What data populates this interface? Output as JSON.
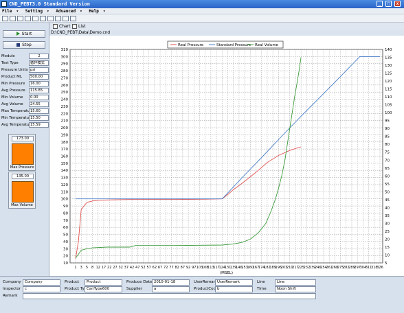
{
  "window": {
    "title": "CND_PEBT3.0 Standard Version"
  },
  "menu": {
    "file": "File",
    "setting": "Setting",
    "advanced": "Advanced",
    "help": "Help"
  },
  "controls": {
    "start_label": "Start",
    "stop_label": "Stop"
  },
  "params": [
    {
      "label": "Module",
      "value": "2"
    },
    {
      "label": "Test Type",
      "value": "循环模式"
    },
    {
      "label": "Pressure Units",
      "value": "psi"
    },
    {
      "label": "Product ML",
      "value": "500.00"
    },
    {
      "label": "Min Pressure",
      "value": "16.00"
    },
    {
      "label": "Avg Pressure",
      "value": "115.85"
    },
    {
      "label": "Min Volume",
      "value": "0.00"
    },
    {
      "label": "Avg Volume",
      "value": "24.55"
    },
    {
      "label": "Max Temperature",
      "value": "15.60"
    },
    {
      "label": "Min Temperature",
      "value": "15.50"
    },
    {
      "label": "Avg Temperature",
      "value": "15.59"
    }
  ],
  "gauges": [
    {
      "value": "173.00",
      "label": "Max Pressure",
      "fill": 1.0
    },
    {
      "value": "135.00",
      "label": "Max Volume",
      "fill": 1.0
    }
  ],
  "tabs": [
    {
      "label": "Chart"
    },
    {
      "label": "List"
    }
  ],
  "file_path": "D:\\CND_PEBT\\Data\\Demo.cnd",
  "colors": {
    "real_pressure": "#e05050",
    "standard_pressure": "#4a7fc8",
    "real_volume": "#3a9a3a",
    "gauge_fill": "#ff8000",
    "title_bar": "#2a64c8"
  },
  "chart_data": {
    "type": "line",
    "xlabel": "(MSEL)",
    "x_ticks": [
      "1",
      "3",
      "5",
      "8",
      "12",
      "17",
      "22",
      "27",
      "32",
      "37",
      "42",
      "47",
      "52",
      "57",
      "62",
      "67",
      "72",
      "77",
      "82",
      "87",
      "92",
      "97",
      "103",
      "108",
      "113",
      "117",
      "124",
      "131",
      "139",
      "146",
      "153",
      "160",
      "167",
      "174",
      "182",
      "189",
      "196",
      "203",
      "210",
      "217",
      "225",
      "232",
      "239",
      "246",
      "254",
      "261",
      "268",
      "275",
      "282",
      "289",
      "297",
      "304",
      "311",
      "318",
      "326"
    ],
    "y_left": {
      "min": 10,
      "max": 310,
      "step": 10
    },
    "y_right": {
      "min": 5,
      "max": 140,
      "step": 5
    },
    "legend_position": "top-center",
    "series": [
      {
        "name": "Real Pressure",
        "axis": "left",
        "color": "#e05050",
        "points": [
          [
            1,
            16
          ],
          [
            2,
            40
          ],
          [
            3,
            85
          ],
          [
            5,
            95
          ],
          [
            8,
            97
          ],
          [
            12,
            98
          ],
          [
            20,
            98.5
          ],
          [
            40,
            99
          ],
          [
            80,
            99
          ],
          [
            110,
            99.5
          ],
          [
            124,
            100
          ],
          [
            131,
            106
          ],
          [
            139,
            113
          ],
          [
            150,
            122
          ],
          [
            160,
            131
          ],
          [
            170,
            140
          ],
          [
            182,
            151
          ],
          [
            196,
            161
          ],
          [
            210,
            168
          ],
          [
            218,
            171
          ],
          [
            225,
            173
          ]
        ]
      },
      {
        "name": "Standard Pressure",
        "axis": "left",
        "color": "#4a7fc8",
        "points": [
          [
            1,
            100
          ],
          [
            60,
            100
          ],
          [
            124,
            100
          ],
          [
            130,
            107
          ],
          [
            150,
            130
          ],
          [
            175,
            159
          ],
          [
            200,
            188
          ],
          [
            225,
            216
          ],
          [
            250,
            244
          ],
          [
            275,
            272
          ],
          [
            300,
            300
          ],
          [
            326,
            300
          ]
        ]
      },
      {
        "name": "Real Volume",
        "axis": "right",
        "color": "#3a9a3a",
        "points": [
          [
            1,
            8
          ],
          [
            3,
            13
          ],
          [
            5,
            14
          ],
          [
            8,
            14.5
          ],
          [
            20,
            15
          ],
          [
            40,
            15
          ],
          [
            45,
            16
          ],
          [
            80,
            16
          ],
          [
            124,
            16.3
          ],
          [
            139,
            17
          ],
          [
            150,
            18
          ],
          [
            160,
            20
          ],
          [
            170,
            24
          ],
          [
            180,
            30
          ],
          [
            187,
            38
          ],
          [
            192,
            45
          ],
          [
            196,
            52
          ],
          [
            200,
            60
          ],
          [
            204,
            70
          ],
          [
            207,
            80
          ],
          [
            210,
            90
          ],
          [
            213,
            100
          ],
          [
            216,
            110
          ],
          [
            219,
            118
          ],
          [
            222,
            126
          ],
          [
            225,
            135
          ]
        ]
      }
    ]
  },
  "bottom": {
    "company": {
      "label": "Company",
      "value": "Company"
    },
    "product": {
      "label": "Product",
      "value": "Product"
    },
    "produce_date": {
      "label": "Produce Date",
      "value": "2010-01-18"
    },
    "user_remark": {
      "label": "UserRemark",
      "value": "UserRemark"
    },
    "line": {
      "label": "Line",
      "value": "Line"
    },
    "inspector": {
      "label": "Inspector",
      "value": "c"
    },
    "product_type": {
      "label": "Product Type",
      "value": "CanType600"
    },
    "supplier": {
      "label": "Supplier",
      "value": "a"
    },
    "product_code": {
      "label": "ProductCode",
      "value": "b"
    },
    "time": {
      "label": "Time",
      "value": "Noon Shift"
    },
    "remark": {
      "label": "Remark",
      "value": ""
    }
  }
}
